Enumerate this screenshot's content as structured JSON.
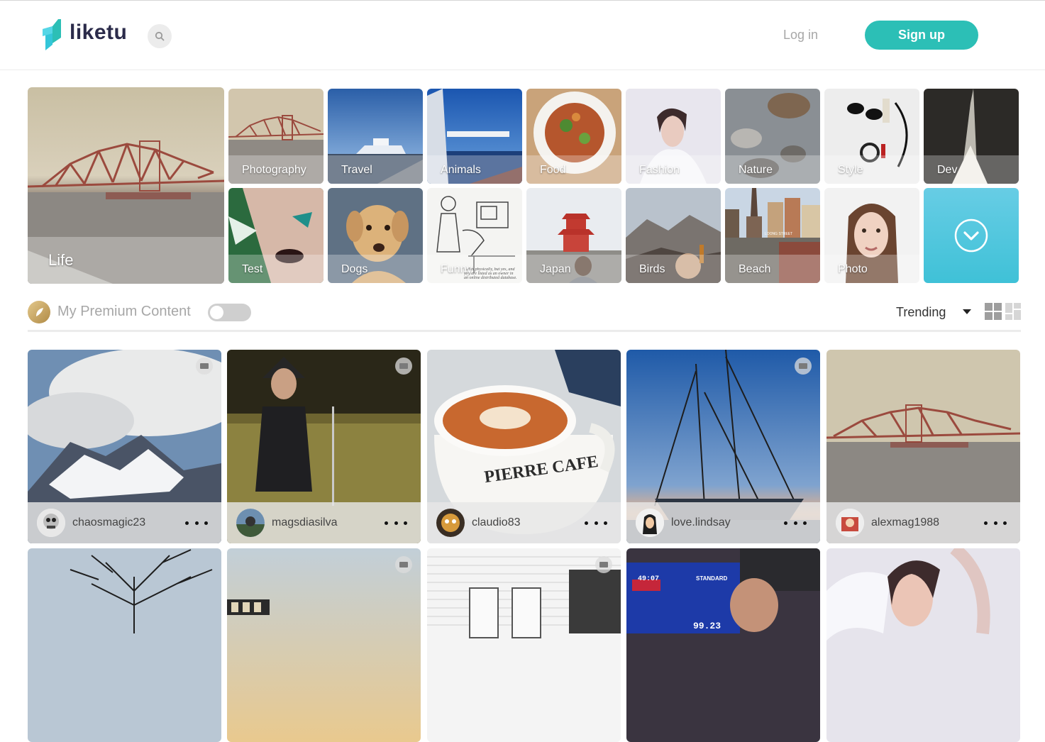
{
  "header": {
    "logo_text": "liketu",
    "login_label": "Log in",
    "signup_label": "Sign up",
    "accent_color": "#2cbfb6"
  },
  "categories": {
    "featured": {
      "label": "Life"
    },
    "items": [
      {
        "label": "Photography"
      },
      {
        "label": "Travel"
      },
      {
        "label": "Animals"
      },
      {
        "label": "Food"
      },
      {
        "label": "Fashion"
      },
      {
        "label": "Nature"
      },
      {
        "label": "Style"
      },
      {
        "label": "Dev"
      },
      {
        "label": "Test"
      },
      {
        "label": "Dogs"
      },
      {
        "label": "Funny"
      },
      {
        "label": "Japan"
      },
      {
        "label": "Birds"
      },
      {
        "label": "Beach"
      },
      {
        "label": "Photo"
      }
    ],
    "more_icon": "chevron-down-icon"
  },
  "filter": {
    "premium_label": "My Premium Content",
    "premium_enabled": false,
    "sort_label": "Trending",
    "view_mode": "grid"
  },
  "posts": [
    {
      "username": "chaosmagic23"
    },
    {
      "username": "magsdiasilva"
    },
    {
      "username": "claudio83"
    },
    {
      "username": "love.lindsay"
    },
    {
      "username": "alexmag1988"
    }
  ],
  "funny_caption": "...dies physically, but yes, and you are listed as an owner in an online distributed database.",
  "cafe_text": "PIERRE CAFE",
  "scoreboard_text": "STANDARD",
  "scoreboard_time": "49:07",
  "scoreboard_value": "99.23",
  "beach_sign": "LOONG STREET"
}
